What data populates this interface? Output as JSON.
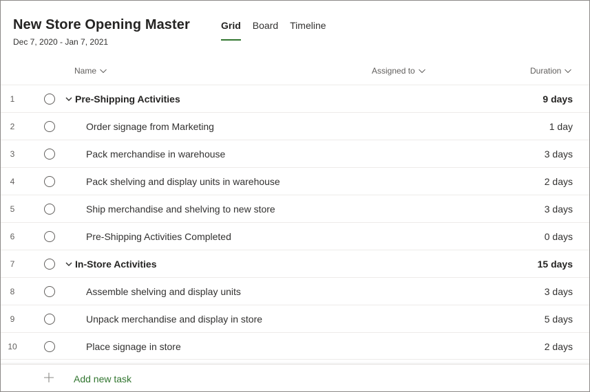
{
  "plan": {
    "title": "New Store Opening Master",
    "date_range": "Dec 7, 2020 - Jan 7, 2021"
  },
  "tabs": [
    {
      "label": "Grid",
      "active": true
    },
    {
      "label": "Board",
      "active": false
    },
    {
      "label": "Timeline",
      "active": false
    }
  ],
  "columns": {
    "name": "Name",
    "assigned_to": "Assigned to",
    "duration": "Duration"
  },
  "tasks": [
    {
      "num": "1",
      "name": "Pre-Shipping Activities",
      "duration": "9 days",
      "summary": true
    },
    {
      "num": "2",
      "name": "Order signage from Marketing",
      "duration": "1 day",
      "summary": false
    },
    {
      "num": "3",
      "name": "Pack merchandise in warehouse",
      "duration": "3 days",
      "summary": false
    },
    {
      "num": "4",
      "name": "Pack shelving and display units in warehouse",
      "duration": "2 days",
      "summary": false
    },
    {
      "num": "5",
      "name": "Ship merchandise and shelving to new store",
      "duration": "3 days",
      "summary": false
    },
    {
      "num": "6",
      "name": "Pre-Shipping Activities Completed",
      "duration": "0 days",
      "summary": false
    },
    {
      "num": "7",
      "name": "In-Store Activities",
      "duration": "15 days",
      "summary": true
    },
    {
      "num": "8",
      "name": "Assemble shelving and display units",
      "duration": "3 days",
      "summary": false
    },
    {
      "num": "9",
      "name": "Unpack merchandise and display in store",
      "duration": "5 days",
      "summary": false
    },
    {
      "num": "10",
      "name": "Place signage in store",
      "duration": "2 days",
      "summary": false
    }
  ],
  "footer": {
    "add_label": "Add new task",
    "add_icon": "plus-icon"
  },
  "colors": {
    "accent": "#31752f",
    "border": "#edebe9"
  }
}
